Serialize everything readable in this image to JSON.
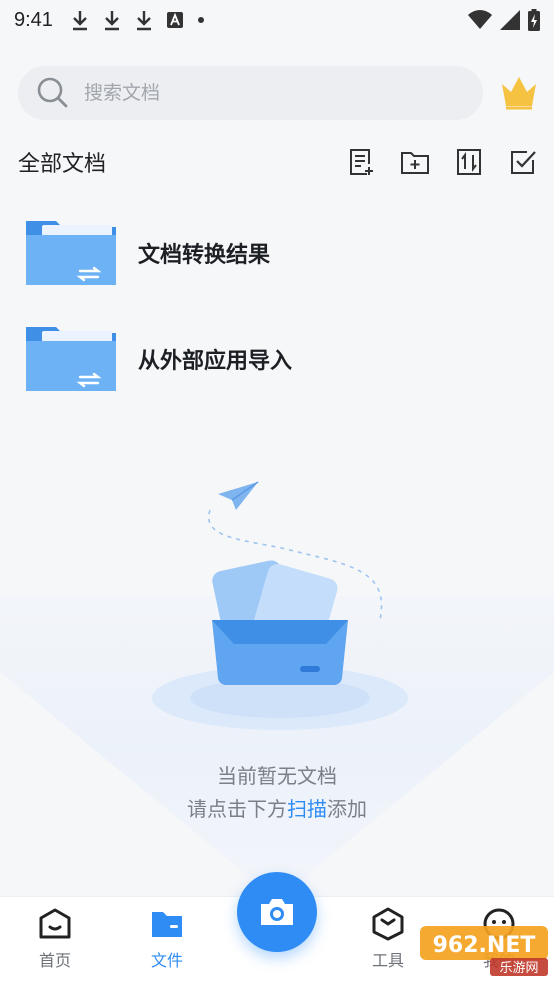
{
  "status_bar": {
    "time": "9:41",
    "icons": [
      "download-icon",
      "download-icon",
      "download-icon",
      "text-a-icon",
      "dot-icon",
      "wifi-icon",
      "signal-icon",
      "battery-charging-icon"
    ]
  },
  "search": {
    "placeholder": "搜索文档",
    "value": ""
  },
  "header": {
    "title": "全部文档",
    "tools": [
      "new-document-icon",
      "new-folder-icon",
      "sort-icon",
      "select-icon"
    ]
  },
  "folders": [
    {
      "label": "文档转换结果",
      "icon": "folder-transfer-icon"
    },
    {
      "label": "从外部应用导入",
      "icon": "folder-transfer-icon"
    }
  ],
  "empty_state": {
    "line1": "当前暂无文档",
    "line2_prefix": "请点击下方",
    "line2_link": "扫描",
    "line2_suffix": "添加"
  },
  "bottom_nav": {
    "items": [
      {
        "label": "首页",
        "icon": "home-icon",
        "active": false
      },
      {
        "label": "文件",
        "icon": "file-icon",
        "active": true
      },
      {
        "label": "工具",
        "icon": "tools-icon",
        "active": false
      },
      {
        "label": "我的",
        "icon": "profile-icon",
        "active": false
      }
    ],
    "camera_icon": "camera-icon"
  },
  "watermark": {
    "text": "962.NET",
    "subtext": "乐游网"
  },
  "colors": {
    "accent": "#2f8cf5",
    "crown": "#f5c242",
    "folder": "#5da8f0",
    "background": "#f6f7f9"
  }
}
